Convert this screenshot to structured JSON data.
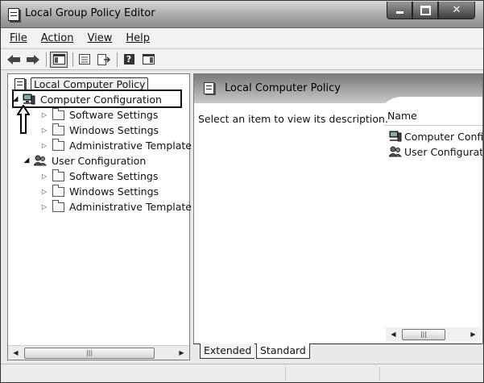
{
  "window": {
    "title": "Local Group Policy Editor"
  },
  "menu": {
    "file": "File",
    "action": "Action",
    "view": "View",
    "help": "Help"
  },
  "toolbar": {
    "icons": [
      "back-icon",
      "forward-icon",
      "show-hide-console-tree-icon",
      "properties-icon",
      "export-list-icon",
      "help-icon",
      "show-hide-action-pane-icon"
    ],
    "help_glyph": "?"
  },
  "tree": {
    "root": "Local Computer Policy",
    "computer_config": "Computer Configuration",
    "computer_children": [
      "Software Settings",
      "Windows Settings",
      "Administrative Template"
    ],
    "user_config": "User Configuration",
    "user_children": [
      "Software Settings",
      "Windows Settings",
      "Administrative Template"
    ]
  },
  "details": {
    "header_title": "Local Computer Policy",
    "description": "Select an item to view its description.",
    "column_name": "Name",
    "rows": [
      "Computer Confi",
      "User Configurati"
    ]
  },
  "tabs": {
    "extended": "Extended",
    "standard": "Standard"
  }
}
